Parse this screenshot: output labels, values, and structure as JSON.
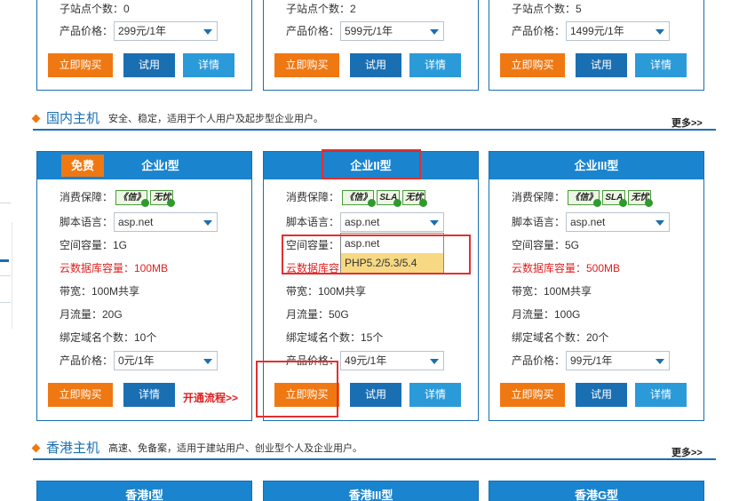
{
  "top_cards": [
    {
      "sites": "子站点个数：0",
      "price_label": "产品价格：",
      "price": "299元/1年"
    },
    {
      "sites": "子站点个数：2",
      "price_label": "产品价格：",
      "price": "599元/1年"
    },
    {
      "sites": "子站点个数：5",
      "price_label": "产品价格：",
      "price": "1499元/1年"
    }
  ],
  "buttons": {
    "buy": "立即购买",
    "trial": "试用",
    "detail": "详情"
  },
  "domestic": {
    "name": "国内主机",
    "desc": "安全、稳定，适用于个人用户及起步型企业用户。",
    "more": "更多>>"
  },
  "hk": {
    "name": "香港主机",
    "desc": "高速、免备案，适用于建站用户、创业型个人及企业用户。",
    "more": "更多>>"
  },
  "labels": {
    "guarantee": "消费保障：",
    "script": "脚本语言：",
    "space": "空间容量：",
    "bandwidth": "带宽：100M共享",
    "domains_prefix": "绑定域名个数：",
    "price": "产品价格："
  },
  "badges": {
    "xin": "《信》",
    "sla": "SLA",
    "wuyou": "无忧"
  },
  "cards": [
    {
      "title": "企业I型",
      "free_tag": "免费",
      "script": "asp.net",
      "space": "空间容量：1G",
      "db": "云数据库容量：100MB",
      "bandwidth": "带宽：100M共享",
      "traffic": "月流量：20G",
      "domains": "绑定域名个数：10个",
      "price": "0元/1年",
      "flow_link": "开通流程>>"
    },
    {
      "title": "企业II型",
      "script": "asp.net",
      "space": "空间容量：",
      "db": "云数据库容",
      "bandwidth": "带宽：100M共享",
      "traffic": "月流量：50G",
      "domains": "绑定域名个数：15个",
      "price": "49元/1年",
      "dropdown_options": [
        "asp.net",
        "PHP5.2/5.3/5.4"
      ]
    },
    {
      "title": "企业III型",
      "script": "asp.net",
      "space": "空间容量：5G",
      "db": "云数据库容量：500MB",
      "bandwidth": "带宽：100M共享",
      "traffic": "月流量：100G",
      "domains": "绑定域名个数：20个",
      "price": "99元/1年"
    }
  ],
  "hk_cards": [
    "香港I型",
    "香港III型",
    "香港G型"
  ],
  "colors": {
    "accent": "#1a84ce",
    "border": "#1a6fb3",
    "orange": "#f07812",
    "red": "#e02020",
    "highlight": "#e03030"
  }
}
